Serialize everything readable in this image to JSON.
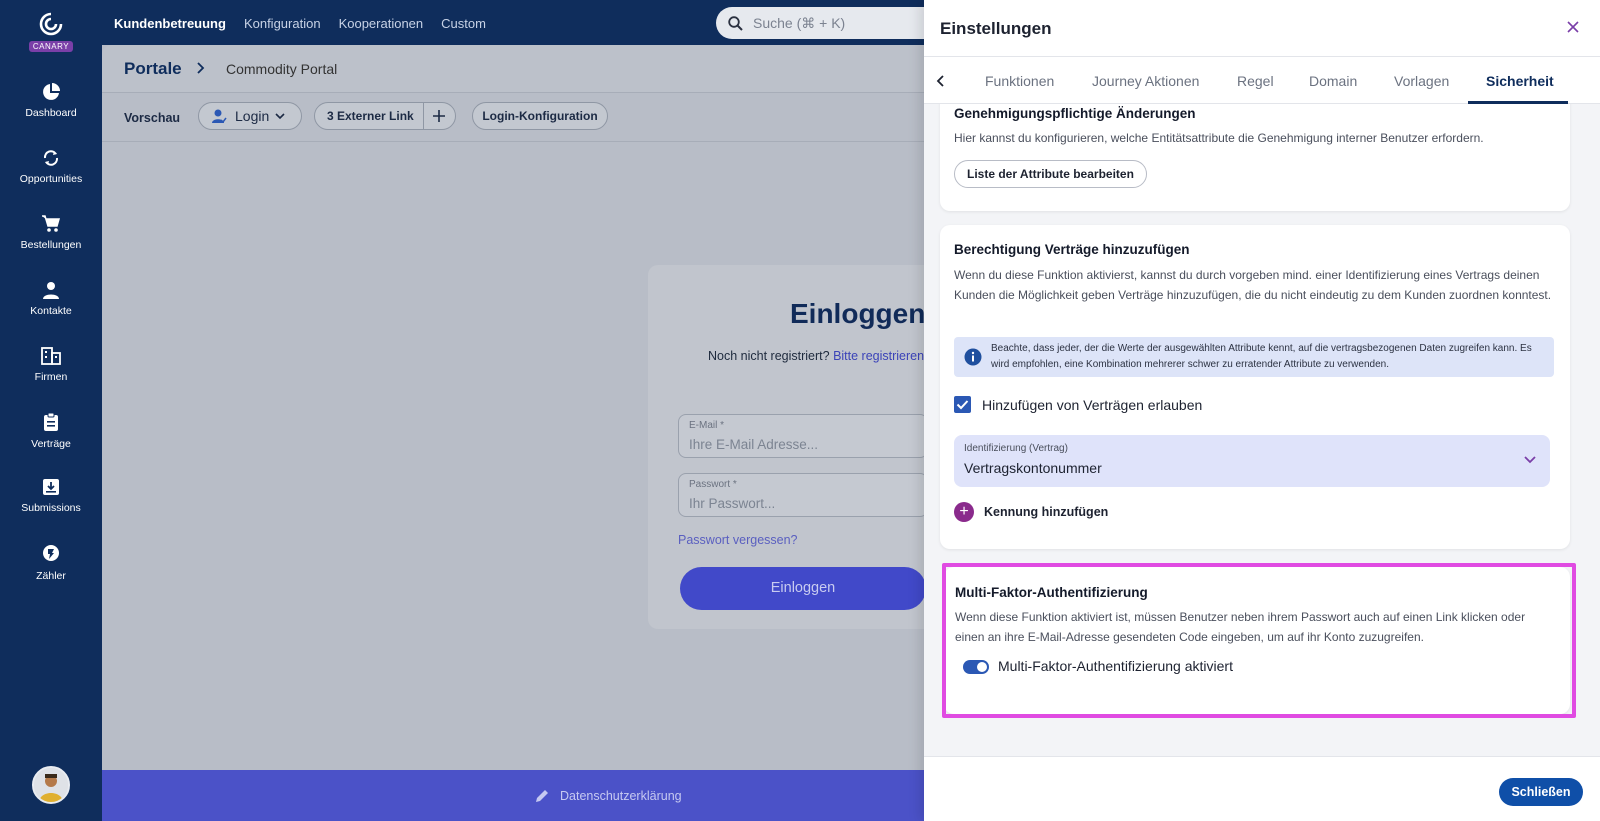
{
  "sidebar": {
    "logo_badge": "CANARY",
    "items": [
      {
        "label": "Dashboard",
        "icon": "pie-chart-icon"
      },
      {
        "label": "Opportunities",
        "icon": "refresh-icon"
      },
      {
        "label": "Bestellungen",
        "icon": "cart-icon"
      },
      {
        "label": "Kontakte",
        "icon": "person-icon"
      },
      {
        "label": "Firmen",
        "icon": "building-icon"
      },
      {
        "label": "Verträge",
        "icon": "clipboard-icon"
      },
      {
        "label": "Submissions",
        "icon": "inbox-icon"
      },
      {
        "label": "Zähler",
        "icon": "meter-icon"
      }
    ]
  },
  "topnav": {
    "items": [
      "Kundenbetreuung",
      "Konfiguration",
      "Kooperationen",
      "Custom"
    ],
    "active_index": 0,
    "search_placeholder": "Suche (⌘ + K)"
  },
  "main": {
    "breadcrumb_title": "Portale",
    "breadcrumb_sub": "Commodity Portal",
    "toolbar": {
      "label": "Vorschau",
      "login_pill": "Login",
      "external_link": "3 Externer Link",
      "login_config": "Login-Konfiguration"
    },
    "login": {
      "title": "Einloggen",
      "not_registered": "Noch nicht registriert?",
      "register_link": "Bitte registrieren",
      "email_label": "E-Mail *",
      "email_placeholder": "Ihre E-Mail Adresse...",
      "password_label": "Passwort *",
      "password_placeholder": "Ihr Passwort...",
      "forgot": "Passwort vergessen?",
      "button": "Einloggen"
    },
    "footer": "Datenschutzerklärung"
  },
  "panel": {
    "title": "Einstellungen",
    "tabs": [
      "Funktionen",
      "Journey Aktionen",
      "Regel",
      "Domain",
      "Vorlagen",
      "Sicherheit"
    ],
    "active_tab": "Sicherheit",
    "approval": {
      "title": "Genehmigungspflichtige Änderungen",
      "text": "Hier kannst du konfigurieren, welche Entitätsattribute die Genehmigung interner Benutzer erfordern.",
      "button": "Liste der Attribute bearbeiten"
    },
    "contracts": {
      "title": "Berechtigung Verträge hinzuzufügen",
      "text": "Wenn du diese Funktion aktivierst, kannst du durch vorgeben mind. einer Identifizierung eines Vertrags deinen Kunden die Möglichkeit geben Verträge hinzuzufügen, die du nicht eindeutig zu dem Kunden zuordnen konntest.",
      "info": "Beachte, dass jeder, der die Werte der ausgewählten Attribute kennt, auf die vertragsbezogenen Daten zugreifen kann. Es wird empfohlen, eine Kombination mehrerer schwer zu erratender Attribute zu verwenden.",
      "checkbox_label": "Hinzufügen von Verträgen erlauben",
      "checkbox_checked": true,
      "select_label": "Identifizierung (Vertrag)",
      "select_value": "Vertragskontonummer",
      "add_label": "Kennung hinzufügen"
    },
    "mfa": {
      "title": "Multi-Faktor-Authentifizierung",
      "text": "Wenn diese Funktion aktiviert ist, müssen Benutzer neben ihrem Passwort auch auf einen Link klicken oder einen an ihre E-Mail-Adresse gesendeten Code eingeben, um auf ihr Konto zuzugreifen.",
      "toggle_label": "Multi-Faktor-Authentifizierung aktiviert",
      "toggle_on": true
    },
    "close_button": "Schließen"
  },
  "colors": {
    "navy": "#0f2d5c",
    "primary_blue": "#2b58b4",
    "highlight": "#e04be2",
    "accent_purple": "#8a2a8c"
  }
}
